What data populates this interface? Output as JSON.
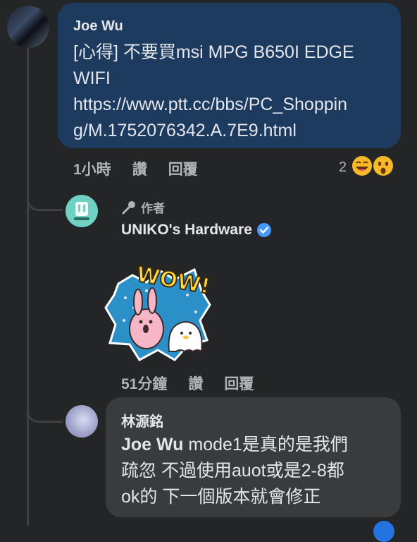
{
  "comment1": {
    "author": "Joe Wu",
    "text_line1": "[心得] 不要買msi MPG B650I EDGE",
    "text_line2": "WIFI",
    "text_line3": "https://www.ptt.cc/bbs/PC_Shoppin",
    "text_line4": "g/M.1752076342.A.7E9.html",
    "time": "1小時",
    "like_label": "讚",
    "reply_label": "回覆",
    "reaction_count": "2",
    "reactions": [
      "laughing-emoji",
      "surprised-emoji"
    ],
    "bubble_color": "#1d3b5e"
  },
  "comment2": {
    "author_badge": "作者",
    "author": "UNIKO's Hardware",
    "verified_color": "#4599ff",
    "sticker_text": "WOW!",
    "time": "51分鐘",
    "like_label": "讚",
    "reply_label": "回覆"
  },
  "comment3": {
    "author": "林源銘",
    "mention": "Joe Wu",
    "text_line1": " mode1是真的是我們",
    "text_line2": "疏忽 不過使用auot或是2-8都",
    "text_line3": "ok的 下一個版本就會修正",
    "bubble_color": "#3a3b3c"
  }
}
